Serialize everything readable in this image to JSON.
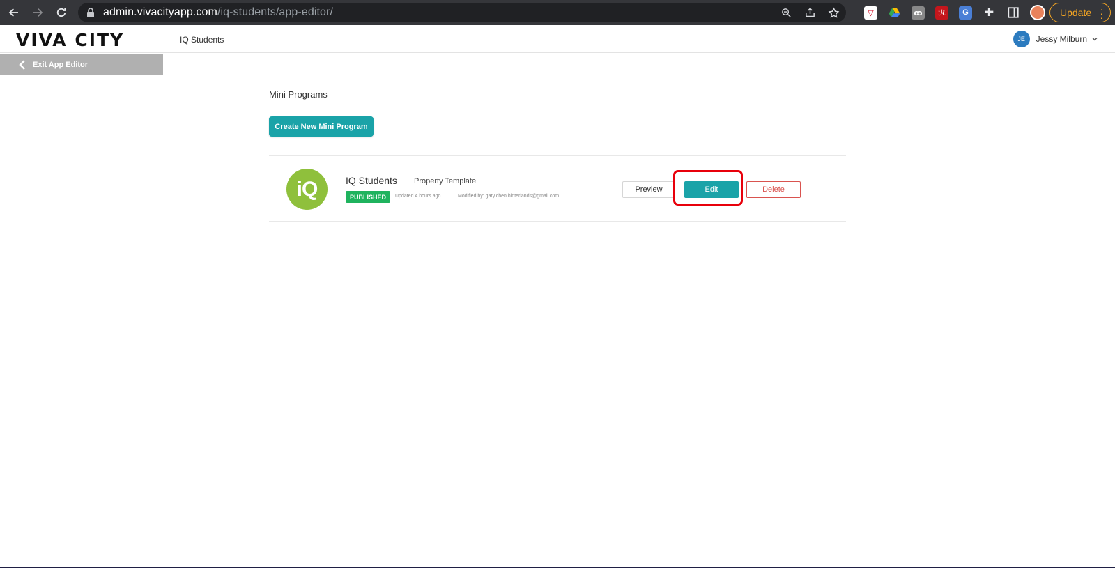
{
  "browser": {
    "url_host": "admin.vivacityapp.com",
    "url_path": "/iq-students/app-editor/",
    "update_label": "Update"
  },
  "header": {
    "logo": "VIVA CITY",
    "app_name": "IQ Students",
    "user_initials": "JE",
    "user_name": "Jessy Milburn"
  },
  "exit": {
    "label": "Exit App Editor"
  },
  "main": {
    "section_title": "Mini Programs",
    "create_label": "Create New Mini Program",
    "programs": [
      {
        "logo_text": "iQ",
        "name": "IQ Students",
        "template": "Property Template",
        "status": "PUBLISHED",
        "updated": "Updated 4 hours ago",
        "modified": "Modified by: gary.chen.hinterlands@gmail.com",
        "preview_label": "Preview",
        "edit_label": "Edit",
        "delete_label": "Delete"
      }
    ]
  },
  "colors": {
    "accent": "#1aa3a8",
    "published": "#1fb35e",
    "delete": "#d9534f",
    "highlight": "#e8000b"
  }
}
